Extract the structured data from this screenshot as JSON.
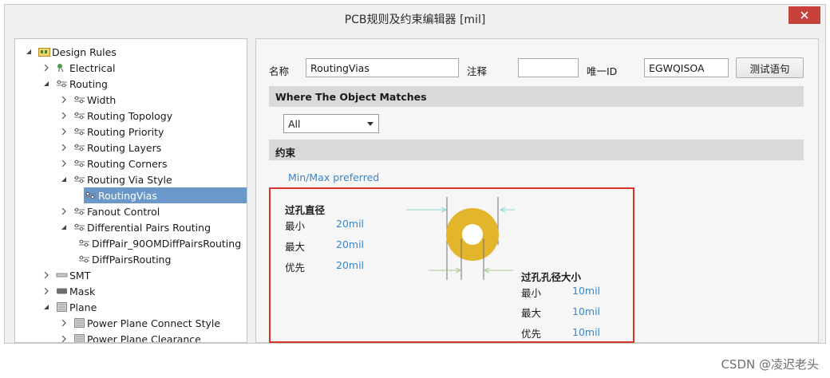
{
  "window": {
    "title": "PCB规则及约束编辑器 [mil]",
    "close_icon": "close-icon"
  },
  "tree": {
    "items": [
      {
        "label": "Design Rules",
        "icon": "design-rules-folder-icon",
        "state": "expanded"
      },
      {
        "label": "Electrical",
        "icon": "electrical-icon",
        "state": "collapsed"
      },
      {
        "label": "Routing",
        "icon": "routing-icon",
        "state": "expanded"
      },
      {
        "label": "Width",
        "icon": "rule-icon",
        "state": "collapsed"
      },
      {
        "label": "Routing Topology",
        "icon": "rule-icon",
        "state": "collapsed"
      },
      {
        "label": "Routing Priority",
        "icon": "rule-icon",
        "state": "collapsed"
      },
      {
        "label": "Routing Layers",
        "icon": "rule-icon",
        "state": "collapsed"
      },
      {
        "label": "Routing Corners",
        "icon": "rule-icon",
        "state": "collapsed"
      },
      {
        "label": "Routing Via Style",
        "icon": "rule-icon",
        "state": "expanded"
      },
      {
        "label": "RoutingVias",
        "icon": "rule-icon",
        "state": "leaf",
        "selected": true
      },
      {
        "label": "Fanout Control",
        "icon": "rule-icon",
        "state": "collapsed"
      },
      {
        "label": "Differential Pairs Routing",
        "icon": "rule-icon",
        "state": "expanded"
      },
      {
        "label": "DiffPair_90OMDiffPairsRouting",
        "icon": "rule-icon",
        "state": "leaf"
      },
      {
        "label": "DiffPairsRouting",
        "icon": "rule-icon",
        "state": "leaf"
      },
      {
        "label": "SMT",
        "icon": "smt-icon",
        "state": "collapsed"
      },
      {
        "label": "Mask",
        "icon": "mask-icon",
        "state": "collapsed"
      },
      {
        "label": "Plane",
        "icon": "plane-icon",
        "state": "expanded"
      },
      {
        "label": "Power Plane Connect Style",
        "icon": "plane-icon",
        "state": "collapsed"
      },
      {
        "label": "Power Plane Clearance",
        "icon": "plane-icon",
        "state": "collapsed"
      }
    ]
  },
  "form": {
    "name_label": "名称",
    "name_value": "RoutingVias",
    "comment_label": "注释",
    "comment_value": "",
    "uid_label": "唯一ID",
    "uid_value": "EGWQISOA",
    "test_button": "测试语句"
  },
  "where": {
    "heading": "Where The Object Matches",
    "scope_value": "All"
  },
  "constraints": {
    "heading": "约束",
    "preference_link": "Min/Max preferred",
    "via_diameter": {
      "heading": "过孔直径",
      "min_label": "最小",
      "min_value": "20mil",
      "max_label": "最大",
      "max_value": "20mil",
      "pref_label": "优先",
      "pref_value": "20mil"
    },
    "hole_size": {
      "heading": "过孔孔径大小",
      "min_label": "最小",
      "min_value": "10mil",
      "max_label": "最大",
      "max_value": "10mil",
      "pref_label": "优先",
      "pref_value": "10mil"
    },
    "colors": {
      "pad": "#e2b52a",
      "highlight": "#d9342b",
      "value": "#3a86c8"
    }
  },
  "watermark": "CSDN @凌迟老头"
}
